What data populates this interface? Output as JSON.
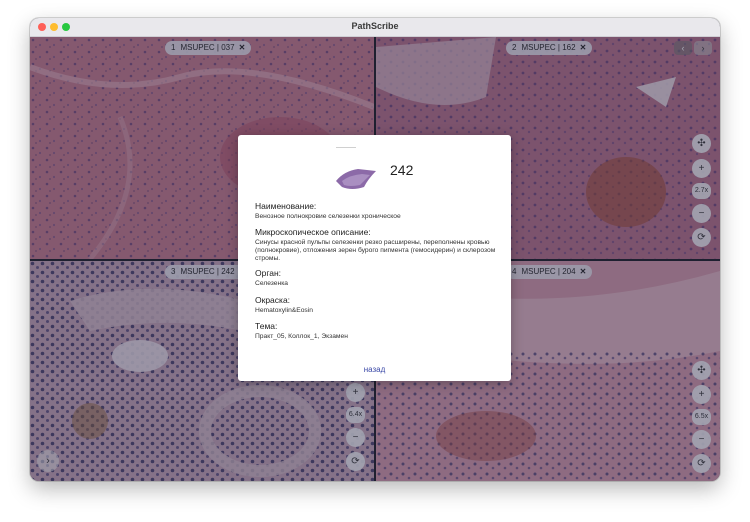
{
  "app": {
    "title": "PathScribe"
  },
  "panes": [
    {
      "number": "1",
      "label": "MSUPEC | 037",
      "close": "✕"
    },
    {
      "number": "2",
      "label": "MSUPEC | 162",
      "close": "✕",
      "zoom": "2.7x"
    },
    {
      "number": "3",
      "label": "MSUPEC | 242",
      "close": "✕",
      "zoom": "6.4x"
    },
    {
      "number": "4",
      "label": "MSUPEC | 204",
      "close": "✕",
      "zoom": "6.5x"
    }
  ],
  "controls": {
    "fit_icon": "crosshair-arrows-icon",
    "zoom_in_label": "+",
    "zoom_out_label": "−",
    "reset_icon": "rotate-icon",
    "nav_next_label": "›",
    "nav_prev_label": "‹",
    "nav_fwd_label": "›"
  },
  "modal": {
    "title": "242",
    "sections": [
      {
        "heading": "Наименование:",
        "value": "Венозное полнокровие селезенки хроническое"
      },
      {
        "heading": "Микроскопическое описание:",
        "value": "Синусы красной пульпы селезенки резко расширены, переполнены кровью (полнокровие), отложения зерен бурого пигмента (гемосидерин) и склерозом стромы."
      },
      {
        "heading": "Орган:",
        "value": "Селезенка"
      },
      {
        "heading": "Окраска:",
        "value": "Hematoxylin&Eosin"
      },
      {
        "heading": "Тема:",
        "value": "Практ_05, Коллок_1, Экзамен"
      }
    ],
    "back_label": "назад"
  },
  "colors": {
    "accent": "#3c4aa8",
    "tissue_pink": "#c9788c",
    "tissue_purple": "#6b4a8a"
  }
}
